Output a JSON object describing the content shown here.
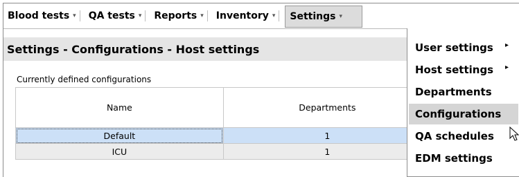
{
  "menubar": {
    "items": [
      {
        "label": "Blood tests",
        "caret": "▾"
      },
      {
        "label": "QA tests",
        "caret": "▾"
      },
      {
        "label": "Reports",
        "caret": "▾"
      },
      {
        "label": "Inventory",
        "caret": "▾"
      },
      {
        "label": "Settings",
        "caret": "▾"
      }
    ]
  },
  "page": {
    "title": "Settings - Configurations - Host settings",
    "caption": "Currently defined configurations"
  },
  "table": {
    "headers": [
      "Name",
      "Departments"
    ],
    "rows": [
      {
        "name": "Default",
        "departments": "1",
        "selected": true
      },
      {
        "name": "ICU",
        "departments": "1",
        "selected": false
      }
    ]
  },
  "settings_menu": {
    "items": [
      {
        "label": "User settings",
        "submenu": "▸"
      },
      {
        "label": "Host settings",
        "submenu": "▸"
      },
      {
        "label": "Departments",
        "submenu": ""
      },
      {
        "label": "Configurations",
        "submenu": ""
      },
      {
        "label": "QA schedules",
        "submenu": ""
      },
      {
        "label": "EDM settings",
        "submenu": ""
      }
    ],
    "hovered": "Configurations"
  },
  "colors": {
    "selected_row": "#cce0f7",
    "header_band": "#e5e5e5",
    "hover_item": "#d5d5d5"
  }
}
